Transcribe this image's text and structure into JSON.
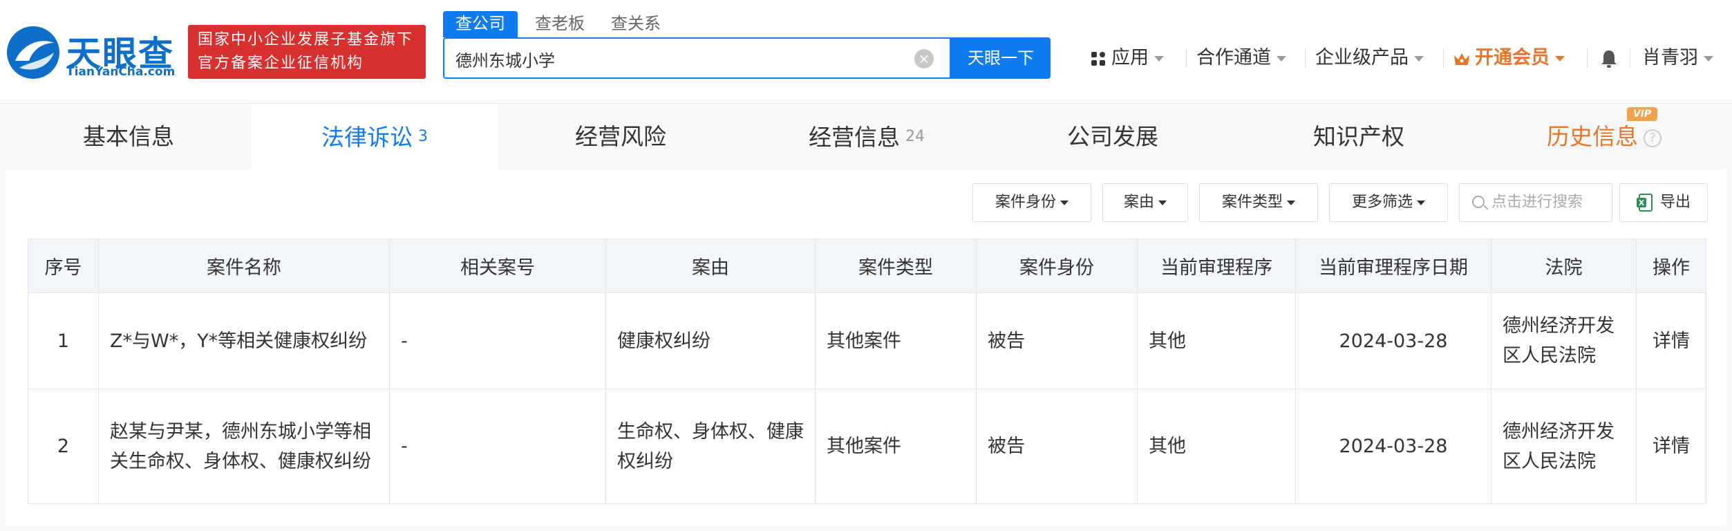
{
  "brand": {
    "name": "天眼查",
    "domain": "TianYanCha.com",
    "badge_line1": "国家中小企业发展子基金旗下",
    "badge_line2": "官方备案企业征信机构",
    "color": "#0d6fc9"
  },
  "search": {
    "tabs": [
      "查公司",
      "查老板",
      "查关系"
    ],
    "active_tab": "查公司",
    "value": "德州东城小学",
    "button": "天眼一下"
  },
  "topnav": {
    "apps": "应用",
    "cooperation": "合作通道",
    "enterprise": "企业级产品",
    "vip": "开通会员",
    "user": "肖青羽"
  },
  "section_tabs": [
    {
      "label": "基本信息",
      "count": ""
    },
    {
      "label": "法律诉讼",
      "count": "3"
    },
    {
      "label": "经营风险",
      "count": ""
    },
    {
      "label": "经营信息",
      "count": "24"
    },
    {
      "label": "公司发展",
      "count": ""
    },
    {
      "label": "知识产权",
      "count": ""
    },
    {
      "label": "历史信息",
      "count": ""
    }
  ],
  "vip_tag": "VIP",
  "filters": {
    "case_role": "案件身份",
    "cause": "案由",
    "case_type": "案件类型",
    "more": "更多筛选",
    "search_placeholder": "点击进行搜索",
    "export": "导出"
  },
  "table": {
    "headers": [
      "序号",
      "案件名称",
      "相关案号",
      "案由",
      "案件类型",
      "案件身份",
      "当前审理程序",
      "当前审理程序日期",
      "法院",
      "操作"
    ],
    "rows": [
      {
        "index": "1",
        "name": "Z*与W*，Y*等相关健康权纠纷",
        "case_no": "-",
        "cause": "健康权纠纷",
        "type": "其他案件",
        "role": "被告",
        "procedure": "其他",
        "date": "2024-03-28",
        "court": "德州经济开发区人民法院",
        "action": "详情"
      },
      {
        "index": "2",
        "name": "赵某与尹某，德州东城小学等相关生命权、身体权、健康权纠纷",
        "case_no": "-",
        "cause": "生命权、身体权、健康权纠纷",
        "type": "其他案件",
        "role": "被告",
        "procedure": "其他",
        "date": "2024-03-28",
        "court": "德州经济开发区人民法院",
        "action": "详情"
      }
    ]
  },
  "colors": {
    "accent": "#0f7bf0",
    "badge_red": "#d8302f",
    "vip_orange": "#e8762a"
  }
}
